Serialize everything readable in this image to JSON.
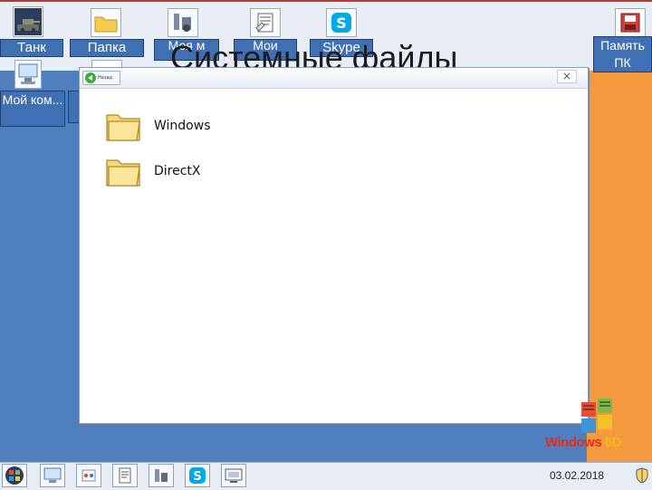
{
  "desktop": {
    "icons": [
      {
        "id": "tank",
        "label": "Танк"
      },
      {
        "id": "folder",
        "label": "Папка"
      },
      {
        "id": "music",
        "label": "Моя м"
      },
      {
        "id": "docs",
        "label": "Мои"
      },
      {
        "id": "skype",
        "label": "Skype"
      },
      {
        "id": "memory",
        "label": "Память ПК"
      },
      {
        "id": "computer",
        "label": "Мой ком..."
      }
    ]
  },
  "slide": {
    "title": "Системные файлы"
  },
  "window": {
    "back_label": "Назад",
    "close_symbol": "×",
    "items": [
      {
        "name": "Windows"
      },
      {
        "name": "DirectX"
      }
    ]
  },
  "logo": {
    "text_main": "Windows",
    "text_num": "8D"
  },
  "taskbar": {
    "date": "03.02.2018",
    "icons": [
      "windows-start-icon",
      "monitor-icon",
      "tools-icon",
      "documents-icon",
      "wrench-icon",
      "skype-icon",
      "computer-icon"
    ]
  },
  "colors": {
    "desktop_blue": "#4f7fbd",
    "orange": "#f39a3e",
    "top_band": "#e9eef6",
    "window_bg": "#ffffff",
    "folder_yellow": "#f4d06a"
  }
}
